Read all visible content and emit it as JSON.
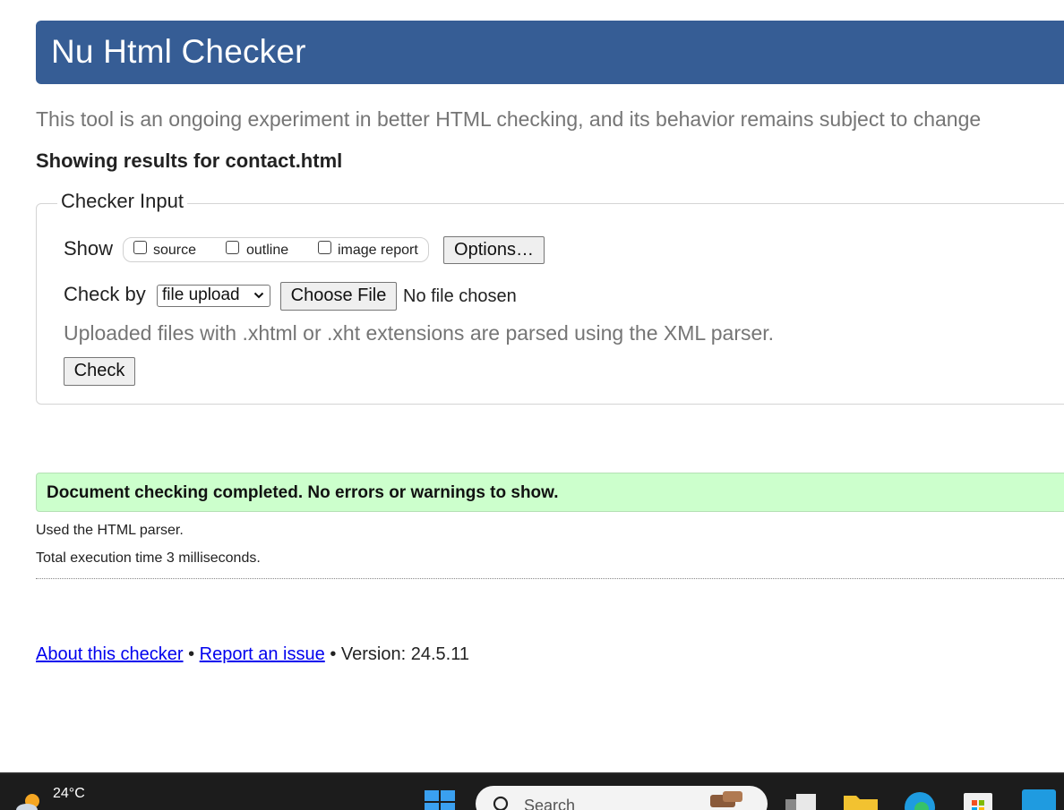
{
  "header": {
    "title": "Nu Html Checker"
  },
  "intro": "This tool is an ongoing experiment in better HTML checking, and its behavior remains subject to change",
  "results_heading": "Showing results for contact.html",
  "checker_input": {
    "legend": "Checker Input",
    "show_label": "Show",
    "show_options": [
      {
        "label": "source",
        "checked": false
      },
      {
        "label": "outline",
        "checked": false
      },
      {
        "label": "image report",
        "checked": false
      }
    ],
    "options_button": "Options…",
    "check_by_label": "Check by",
    "check_by_selected": "file upload",
    "choose_file_button": "Choose File",
    "file_status": "No file chosen",
    "note": "Uploaded files with .xhtml or .xht extensions are parsed using the XML parser.",
    "check_button": "Check"
  },
  "result": {
    "message": "Document checking completed. No errors or warnings to show.",
    "parser_info": "Used the HTML parser.",
    "execution_time": "Total execution time 3 milliseconds."
  },
  "footer": {
    "about_link": "About this checker",
    "separator": "•",
    "report_link": "Report an issue",
    "version": "Version: 24.5.11"
  },
  "taskbar": {
    "temperature": "24°C",
    "search_placeholder": "Search",
    "icons": [
      "weather-icon",
      "windows-start-icon",
      "search-icon",
      "search-highlight-icon",
      "task-view-icon",
      "file-explorer-icon",
      "edge-browser-icon",
      "microsoft-store-icon",
      "myhp-icon"
    ]
  },
  "colors": {
    "header_bg": "#365d95",
    "success_bg": "#ccffcc",
    "link": "#0000ee",
    "muted_text": "#757575"
  }
}
